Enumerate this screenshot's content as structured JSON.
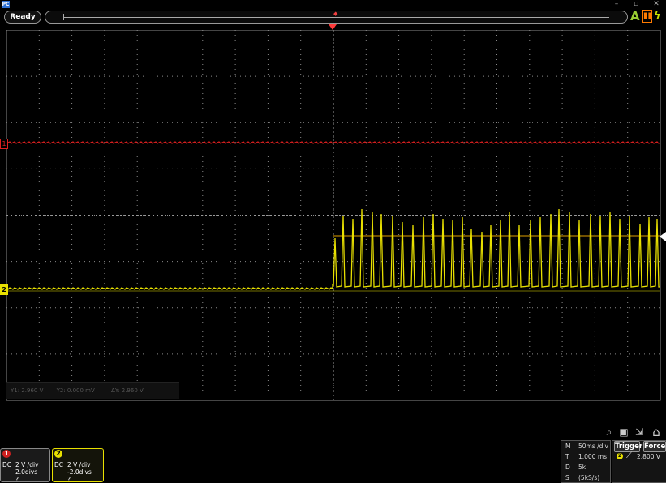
{
  "status": "Ready",
  "app_logo": "PC",
  "window": {
    "minimize": "–",
    "maximize": "▫",
    "close": "✕"
  },
  "icons": {
    "auto": "A",
    "run": "▮▮",
    "flash": "ϟ",
    "zoom": "⌕",
    "save": "▣",
    "export": "⇲",
    "home": "⌂"
  },
  "colors": {
    "ch1": "#e02020",
    "ch2": "#e8e000",
    "grid": "#8a8a8a",
    "trigger_marker": "#ff3a3a"
  },
  "cursor_readout": {
    "y1": "Y1: 2.960 V",
    "y2": "Y2: 0.000 mV",
    "dy": "ΔY: 2.960 V"
  },
  "channel1": {
    "badge": "1",
    "marker": "1",
    "coupling": "DC",
    "scale": "2 V /div",
    "offset": "2.0divs",
    "extra": "?"
  },
  "channel2": {
    "badge": "2",
    "marker": "2",
    "coupling": "DC",
    "scale": "2 V /div",
    "offset": "-2.0divs",
    "extra": "?"
  },
  "timebase": {
    "rows": [
      {
        "key": "M",
        "value": "50ms /div"
      },
      {
        "key": "T",
        "value": "1.000 ms"
      },
      {
        "key": "D",
        "value": "5k"
      },
      {
        "key": "S",
        "value": "(5kS/s)"
      }
    ]
  },
  "trigger": {
    "trigger_label": "Trigger",
    "force_label": "Force",
    "source": "2",
    "slope": "⟋",
    "level": "2.800 V"
  }
}
